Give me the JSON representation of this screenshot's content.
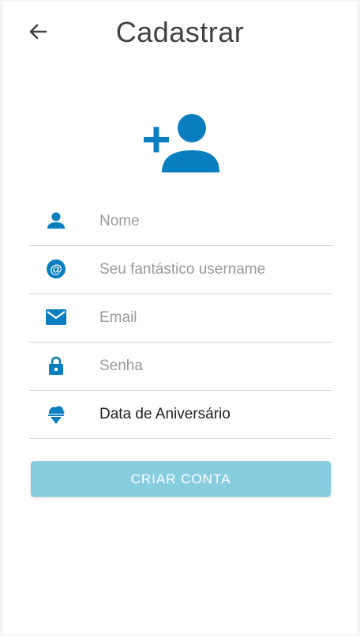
{
  "header": {
    "title": "Cadastrar",
    "back_icon": "arrow-back-icon"
  },
  "hero": {
    "icon": "person-add-icon"
  },
  "form": {
    "fields": [
      {
        "icon": "person-icon",
        "placeholder": "Nome",
        "value": ""
      },
      {
        "icon": "at-icon",
        "placeholder": "Seu fantástico username",
        "value": ""
      },
      {
        "icon": "email-icon",
        "placeholder": "Email",
        "value": ""
      },
      {
        "icon": "lock-icon",
        "placeholder": "Senha",
        "value": ""
      },
      {
        "icon": "cake-icon",
        "label": "Data de Aniversário"
      }
    ],
    "submit_label": "CRIAR CONTA"
  },
  "colors": {
    "accent": "#0a7fbf",
    "button": "#87cde0",
    "title": "#424242",
    "divider": "#d6d6d6"
  }
}
